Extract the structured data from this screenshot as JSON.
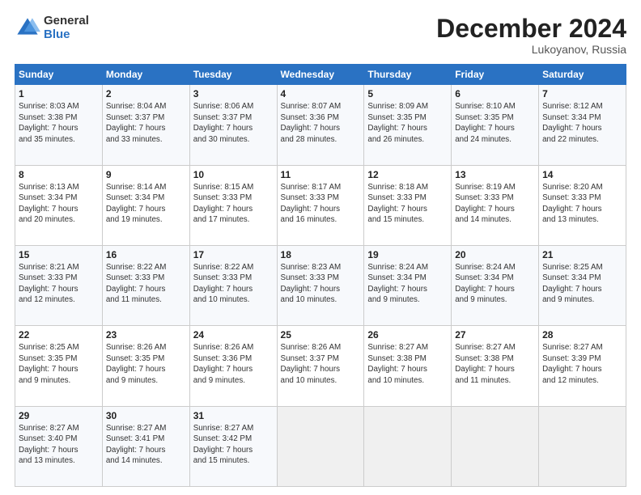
{
  "logo": {
    "general": "General",
    "blue": "Blue"
  },
  "title": "December 2024",
  "location": "Lukoyanov, Russia",
  "days_header": [
    "Sunday",
    "Monday",
    "Tuesday",
    "Wednesday",
    "Thursday",
    "Friday",
    "Saturday"
  ],
  "weeks": [
    [
      {
        "day": "1",
        "info": "Sunrise: 8:03 AM\nSunset: 3:38 PM\nDaylight: 7 hours\nand 35 minutes."
      },
      {
        "day": "2",
        "info": "Sunrise: 8:04 AM\nSunset: 3:37 PM\nDaylight: 7 hours\nand 33 minutes."
      },
      {
        "day": "3",
        "info": "Sunrise: 8:06 AM\nSunset: 3:37 PM\nDaylight: 7 hours\nand 30 minutes."
      },
      {
        "day": "4",
        "info": "Sunrise: 8:07 AM\nSunset: 3:36 PM\nDaylight: 7 hours\nand 28 minutes."
      },
      {
        "day": "5",
        "info": "Sunrise: 8:09 AM\nSunset: 3:35 PM\nDaylight: 7 hours\nand 26 minutes."
      },
      {
        "day": "6",
        "info": "Sunrise: 8:10 AM\nSunset: 3:35 PM\nDaylight: 7 hours\nand 24 minutes."
      },
      {
        "day": "7",
        "info": "Sunrise: 8:12 AM\nSunset: 3:34 PM\nDaylight: 7 hours\nand 22 minutes."
      }
    ],
    [
      {
        "day": "8",
        "info": "Sunrise: 8:13 AM\nSunset: 3:34 PM\nDaylight: 7 hours\nand 20 minutes."
      },
      {
        "day": "9",
        "info": "Sunrise: 8:14 AM\nSunset: 3:34 PM\nDaylight: 7 hours\nand 19 minutes."
      },
      {
        "day": "10",
        "info": "Sunrise: 8:15 AM\nSunset: 3:33 PM\nDaylight: 7 hours\nand 17 minutes."
      },
      {
        "day": "11",
        "info": "Sunrise: 8:17 AM\nSunset: 3:33 PM\nDaylight: 7 hours\nand 16 minutes."
      },
      {
        "day": "12",
        "info": "Sunrise: 8:18 AM\nSunset: 3:33 PM\nDaylight: 7 hours\nand 15 minutes."
      },
      {
        "day": "13",
        "info": "Sunrise: 8:19 AM\nSunset: 3:33 PM\nDaylight: 7 hours\nand 14 minutes."
      },
      {
        "day": "14",
        "info": "Sunrise: 8:20 AM\nSunset: 3:33 PM\nDaylight: 7 hours\nand 13 minutes."
      }
    ],
    [
      {
        "day": "15",
        "info": "Sunrise: 8:21 AM\nSunset: 3:33 PM\nDaylight: 7 hours\nand 12 minutes."
      },
      {
        "day": "16",
        "info": "Sunrise: 8:22 AM\nSunset: 3:33 PM\nDaylight: 7 hours\nand 11 minutes."
      },
      {
        "day": "17",
        "info": "Sunrise: 8:22 AM\nSunset: 3:33 PM\nDaylight: 7 hours\nand 10 minutes."
      },
      {
        "day": "18",
        "info": "Sunrise: 8:23 AM\nSunset: 3:33 PM\nDaylight: 7 hours\nand 10 minutes."
      },
      {
        "day": "19",
        "info": "Sunrise: 8:24 AM\nSunset: 3:34 PM\nDaylight: 7 hours\nand 9 minutes."
      },
      {
        "day": "20",
        "info": "Sunrise: 8:24 AM\nSunset: 3:34 PM\nDaylight: 7 hours\nand 9 minutes."
      },
      {
        "day": "21",
        "info": "Sunrise: 8:25 AM\nSunset: 3:34 PM\nDaylight: 7 hours\nand 9 minutes."
      }
    ],
    [
      {
        "day": "22",
        "info": "Sunrise: 8:25 AM\nSunset: 3:35 PM\nDaylight: 7 hours\nand 9 minutes."
      },
      {
        "day": "23",
        "info": "Sunrise: 8:26 AM\nSunset: 3:35 PM\nDaylight: 7 hours\nand 9 minutes."
      },
      {
        "day": "24",
        "info": "Sunrise: 8:26 AM\nSunset: 3:36 PM\nDaylight: 7 hours\nand 9 minutes."
      },
      {
        "day": "25",
        "info": "Sunrise: 8:26 AM\nSunset: 3:37 PM\nDaylight: 7 hours\nand 10 minutes."
      },
      {
        "day": "26",
        "info": "Sunrise: 8:27 AM\nSunset: 3:38 PM\nDaylight: 7 hours\nand 10 minutes."
      },
      {
        "day": "27",
        "info": "Sunrise: 8:27 AM\nSunset: 3:38 PM\nDaylight: 7 hours\nand 11 minutes."
      },
      {
        "day": "28",
        "info": "Sunrise: 8:27 AM\nSunset: 3:39 PM\nDaylight: 7 hours\nand 12 minutes."
      }
    ],
    [
      {
        "day": "29",
        "info": "Sunrise: 8:27 AM\nSunset: 3:40 PM\nDaylight: 7 hours\nand 13 minutes."
      },
      {
        "day": "30",
        "info": "Sunrise: 8:27 AM\nSunset: 3:41 PM\nDaylight: 7 hours\nand 14 minutes."
      },
      {
        "day": "31",
        "info": "Sunrise: 8:27 AM\nSunset: 3:42 PM\nDaylight: 7 hours\nand 15 minutes."
      },
      null,
      null,
      null,
      null
    ]
  ]
}
